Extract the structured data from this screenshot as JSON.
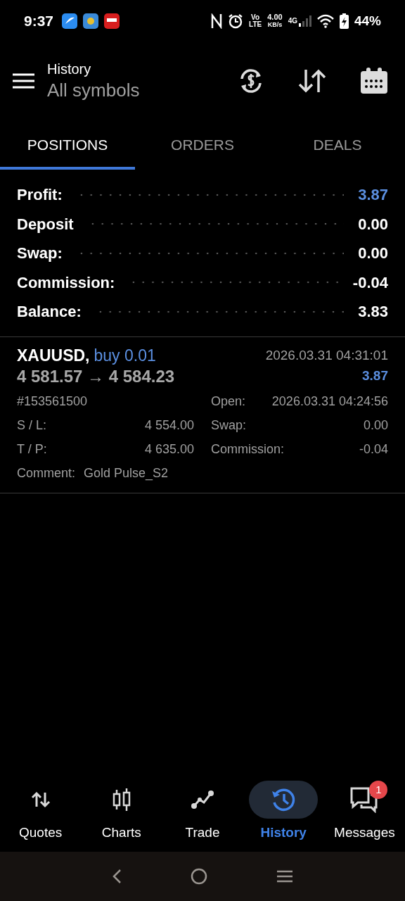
{
  "status_bar": {
    "time": "9:37",
    "volte": "Vo",
    "lte": "LTE",
    "speed": "4.00",
    "speed_unit": "KB/s",
    "network": "4G",
    "battery": "44%"
  },
  "header": {
    "title": "History",
    "subtitle": "All symbols"
  },
  "tabs": [
    {
      "label": "POSITIONS",
      "selected": true
    },
    {
      "label": "ORDERS",
      "selected": false
    },
    {
      "label": "DEALS",
      "selected": false
    }
  ],
  "summary": [
    {
      "label": "Profit:",
      "value": "3.87",
      "accent": true
    },
    {
      "label": "Deposit",
      "value": "0.00",
      "accent": false
    },
    {
      "label": "Swap:",
      "value": "0.00",
      "accent": false
    },
    {
      "label": "Commission:",
      "value": "-0.04",
      "accent": false
    },
    {
      "label": "Balance:",
      "value": "3.83",
      "accent": false
    }
  ],
  "positions": [
    {
      "symbol": "XAUUSD,",
      "side": "buy 0.01",
      "prices": "4 581.57 → 4 584.23",
      "close_time": "2026.03.31 04:31:01",
      "profit": "3.87",
      "ticket": "#153561500",
      "open_label": "Open:",
      "open_time": "2026.03.31 04:24:56",
      "sl_label": "S / L:",
      "sl": "4 554.00",
      "swap_label": "Swap:",
      "swap": "0.00",
      "tp_label": "T / P:",
      "tp": "4 635.00",
      "commission_label": "Commission:",
      "commission": "-0.04",
      "comment_label": "Comment:",
      "comment": "Gold Pulse_S2"
    }
  ],
  "bottom_nav": [
    {
      "label": "Quotes",
      "selected": false
    },
    {
      "label": "Charts",
      "selected": false
    },
    {
      "label": "Trade",
      "selected": false
    },
    {
      "label": "History",
      "selected": true
    },
    {
      "label": "Messages",
      "selected": false,
      "badge": "1"
    }
  ]
}
